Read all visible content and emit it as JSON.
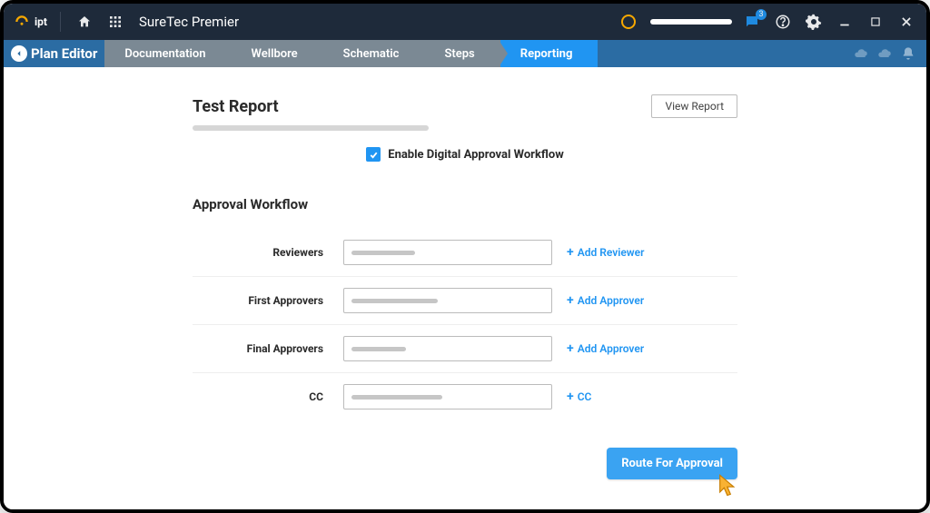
{
  "topbar": {
    "logo_text": "ipt",
    "app_title": "SureTec Premier",
    "chat_count": "3"
  },
  "breadcrumb": {
    "back_label": "Plan Editor",
    "items": [
      "Documentation",
      "Wellbore",
      "Schematic",
      "Steps",
      "Reporting"
    ],
    "active_index": 4
  },
  "report": {
    "title": "Test Report",
    "view_label": "View Report",
    "enable_label": "Enable Digital Approval Workflow",
    "enable_checked": true
  },
  "workflow": {
    "section_title": "Approval Workflow",
    "rows": [
      {
        "label": "Reviewers",
        "add_label": "Add Reviewer",
        "ph_width": 70
      },
      {
        "label": "First Approvers",
        "add_label": "Add Approver",
        "ph_width": 95
      },
      {
        "label": "Final Approvers",
        "add_label": "Add Approver",
        "ph_width": 60
      },
      {
        "label": "CC",
        "add_label": "CC",
        "ph_width": 100
      }
    ],
    "route_label": "Route For Approval"
  }
}
